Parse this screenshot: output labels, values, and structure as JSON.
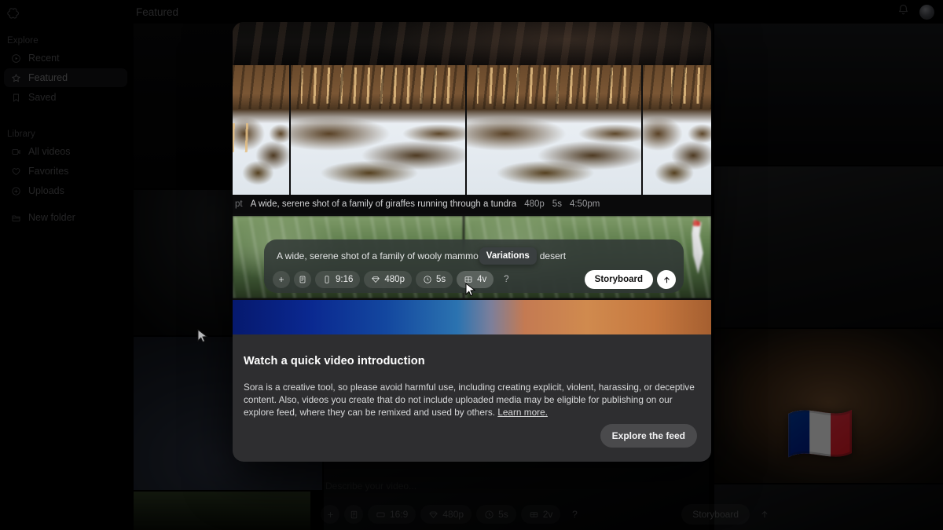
{
  "app": {
    "logo_icon": "openai-logo-icon",
    "accent_white": "#ffffff",
    "modal_bg": "#2e2e30",
    "surface_bg": "#0d0d0e"
  },
  "header": {
    "title": "Featured",
    "notifications_icon": "bell-icon",
    "avatar_label": "account-avatar"
  },
  "sidebar": {
    "sections": [
      {
        "label": "Explore",
        "items": [
          {
            "label": "Recent",
            "icon": "clock-play-icon",
            "active": false
          },
          {
            "label": "Featured",
            "icon": "star-icon",
            "active": true
          },
          {
            "label": "Saved",
            "icon": "bookmark-icon",
            "active": false
          }
        ]
      },
      {
        "label": "Library",
        "items": [
          {
            "label": "All videos",
            "icon": "video-box-icon",
            "active": false
          },
          {
            "label": "Favorites",
            "icon": "heart-icon",
            "active": false
          },
          {
            "label": "Uploads",
            "icon": "plus-circle-icon",
            "active": false
          },
          {
            "label": "New folder",
            "icon": "folder-plus-icon",
            "active": false
          }
        ]
      }
    ]
  },
  "video_card": {
    "prompt_label": "pt",
    "prompt": "A wide, serene shot of a family of giraffes running through a tundra",
    "resolution": "480p",
    "duration": "5s",
    "time": "4:50pm"
  },
  "composer": {
    "prompt_text": "A wide, serene shot of a family of wooly mammo",
    "tooltip": "Variations",
    "trailing_text": "desert",
    "controls": [
      {
        "name": "add-button",
        "icon": "plus-icon",
        "label": ""
      },
      {
        "name": "storyboard-button",
        "icon": "storyboard-icon",
        "label": ""
      },
      {
        "name": "aspect-ratio",
        "icon": "portrait-icon",
        "label": "9:16"
      },
      {
        "name": "resolution",
        "icon": "diamond-icon",
        "label": "480p"
      },
      {
        "name": "duration",
        "icon": "clock-icon",
        "label": "5s"
      },
      {
        "name": "variations",
        "icon": "grid-icon",
        "label": "4v",
        "selected": true
      },
      {
        "name": "help",
        "icon": "question-icon",
        "label": "?"
      }
    ],
    "storyboard_label": "Storyboard",
    "submit_icon": "arrow-up-icon"
  },
  "modal": {
    "title": "Watch a quick video introduction",
    "body_part1": "Sora is a creative tool, so please avoid harmful use, including creating explicit, violent, harassing, or deceptive content. Also, videos you create that do not include uploaded media may be eligible for publishing on our explore feed, where they can be remixed and used by others. ",
    "learn_more": "Learn more.",
    "primary_button": "Explore the feed"
  },
  "bottom_composer": {
    "placeholder": "Describe your video...",
    "controls": [
      {
        "name": "add-button",
        "icon": "plus-icon",
        "label": ""
      },
      {
        "name": "storyboard-button",
        "icon": "storyboard-icon",
        "label": ""
      },
      {
        "name": "aspect-ratio",
        "icon": "landscape-icon",
        "label": "16:9"
      },
      {
        "name": "resolution",
        "icon": "diamond-icon",
        "label": "480p"
      },
      {
        "name": "duration",
        "icon": "clock-icon",
        "label": "5s"
      },
      {
        "name": "variations",
        "icon": "grid-icon",
        "label": "2v"
      },
      {
        "name": "help",
        "icon": "question-icon",
        "label": "?"
      }
    ],
    "storyboard_label": "Storyboard",
    "submit_icon": "arrow-up-icon"
  },
  "feed": {
    "flag_emoji": "🇫🇷"
  }
}
